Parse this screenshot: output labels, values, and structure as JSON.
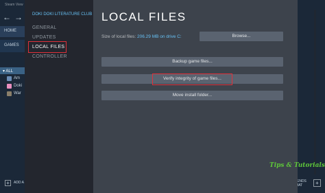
{
  "steam_bg": {
    "menu_label": "Steam  View",
    "nav": {
      "back_glyph": "←",
      "forward_glyph": "→"
    },
    "home_label": "HOME",
    "games_label": "GAMES",
    "all_label": "▾ ALL",
    "games": [
      {
        "label": "Am",
        "icon_color": "#6b8db5"
      },
      {
        "label": "Doki",
        "icon_color": "#e88fbf"
      },
      {
        "label": "War",
        "icon_color": "#8a7f6a"
      }
    ],
    "add_label": "ADD A",
    "close_glyph": "✕",
    "friends": {
      "line1": "RIENDS",
      "line2": "CHAT",
      "plus": "+"
    }
  },
  "dialog": {
    "game_title": "DOKI DOKI LITERATURE CLUB",
    "side_items": [
      "GENERAL",
      "UPDATES",
      "LOCAL FILES",
      "CONTROLLER"
    ],
    "heading": "LOCAL FILES",
    "size_label": "Size of local files:",
    "size_value": "206.29 MB on drive C:",
    "buttons": {
      "browse": "Browse...",
      "backup": "Backup game files...",
      "verify": "Verify integrity of game files...",
      "move": "Move install folder..."
    }
  },
  "watermark": "Tips & Tutorials",
  "colors": {
    "accent": "#67c1f5",
    "highlight_box": "#e0313a",
    "watermark": "#5ec53a"
  }
}
